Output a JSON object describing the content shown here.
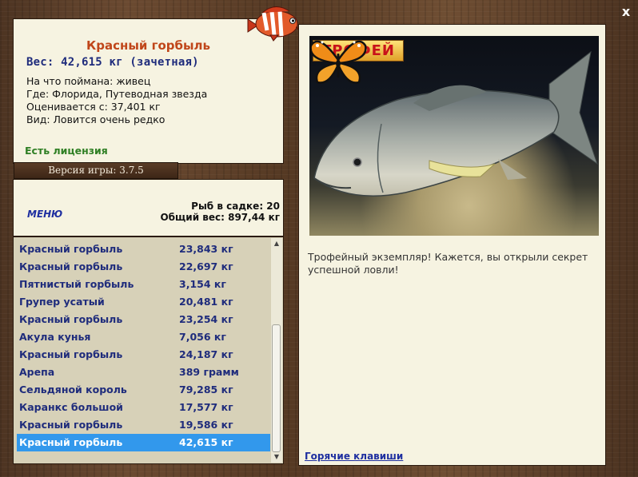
{
  "window": {
    "close_label": "x"
  },
  "info": {
    "title": "Красный горбыль",
    "weight": "Вес: 42,615 кг (зачетная)",
    "caught_on": "На что поймана: живец",
    "location": "Где: Флорида, Путеводная звезда",
    "valued_from": "Оценивается с: 37,401 кг",
    "rarity": "Вид: Ловится очень редко",
    "license": "Есть лицензия"
  },
  "version_label": "Версия игры: 3.7.5",
  "stats": {
    "menu_label": "МЕНЮ",
    "keep_count": "Рыб в садке: 20",
    "total_weight": "Общий вес: 897,44 кг"
  },
  "catch_list": [
    {
      "name": "Красный горбыль",
      "weight": "23,843 кг"
    },
    {
      "name": "Красный горбыль",
      "weight": "22,697 кг"
    },
    {
      "name": "Пятнистый горбыль",
      "weight": "3,154 кг"
    },
    {
      "name": "Групер усатый",
      "weight": "20,481 кг"
    },
    {
      "name": "Красный горбыль",
      "weight": "23,254 кг"
    },
    {
      "name": "Акула кунья",
      "weight": "7,056 кг"
    },
    {
      "name": "Красный горбыль",
      "weight": "24,187 кг"
    },
    {
      "name": "Арепа",
      "weight": "389 грамм"
    },
    {
      "name": "Сельдяной король",
      "weight": "79,285 кг"
    },
    {
      "name": "Каранкс большой",
      "weight": "17,577 кг"
    },
    {
      "name": "Красный горбыль",
      "weight": "19,586 кг"
    },
    {
      "name": "Красный горбыль",
      "weight": "42,615 кг",
      "selected": true
    }
  ],
  "trophy": {
    "badge": "ТРОФЕЙ",
    "description": "Трофейный экземпляр! Кажется, вы открыли секрет успешной ловли!"
  },
  "hotkeys_label": "Горячие клавиши",
  "colors": {
    "title": "#c0461a",
    "weight": "#1f2c7c",
    "license": "#2f7f24",
    "selection": "#3298ec",
    "panel": "#f6f3e1"
  },
  "icons": [
    "logo-fish-icon",
    "butterfly-icon",
    "scroll-up-icon",
    "scroll-down-icon",
    "close-icon"
  ]
}
